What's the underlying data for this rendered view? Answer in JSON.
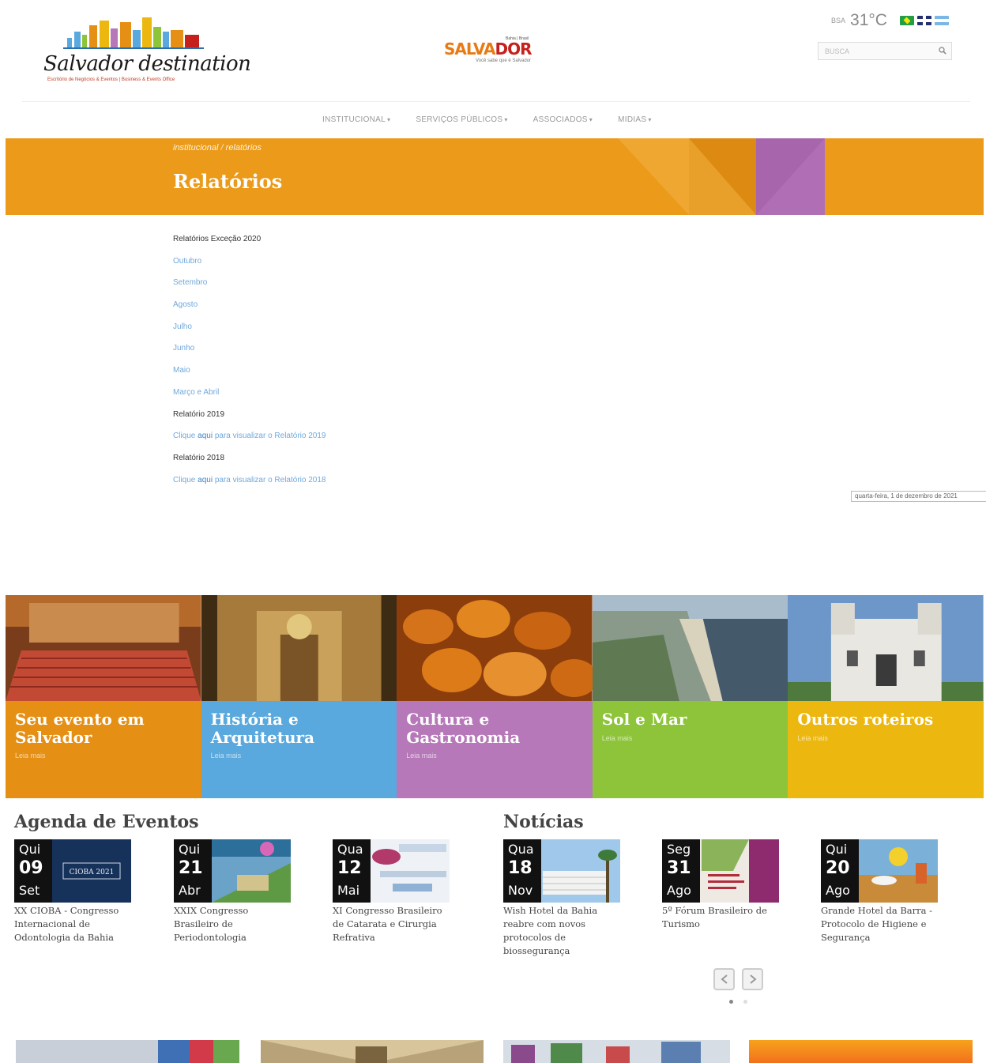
{
  "header": {
    "logo_text": "Salvador destination",
    "logo_subtitle": "Escritório de Negócios & Eventos | Business & Events Office",
    "center_logo_top": "Bahia | Brasil",
    "center_logo_word_a": "SALVA",
    "center_logo_word_b": "DOR",
    "center_logo_tagline": "Você sabe que é Salvador",
    "weather_city": "BSA",
    "weather_temp": "31°C",
    "search_placeholder": "BUSCA"
  },
  "nav": {
    "items": [
      {
        "label": "INSTITUCIONAL"
      },
      {
        "label": "SERVIÇOS PÚBLICOS"
      },
      {
        "label": "ASSOCIADOS"
      },
      {
        "label": "MIDIAS"
      }
    ],
    "caret": "▾"
  },
  "banner": {
    "crumb_a": "institucional",
    "crumb_sep": " / ",
    "crumb_b": "relatórios",
    "title": "Relatórios",
    "colors": {
      "base": "#eb9a19",
      "accent": "#b06fb4"
    }
  },
  "content": {
    "items": [
      {
        "type": "heading",
        "text": "Relatórios Exceção 2020"
      },
      {
        "type": "link",
        "text": "Outubro"
      },
      {
        "type": "link",
        "text": "Setembro"
      },
      {
        "type": "link",
        "text": "Agosto"
      },
      {
        "type": "link",
        "text": "Julho"
      },
      {
        "type": "link",
        "text": "Junho"
      },
      {
        "type": "link",
        "text": "Maio"
      },
      {
        "type": "link",
        "text": "Março e Abril"
      },
      {
        "type": "heading",
        "text": "Relatório 2019"
      },
      {
        "type": "link",
        "prefix": "Clique ",
        "here": "aqui",
        "suffix": " para visualizar o Relatório 2019"
      },
      {
        "type": "heading",
        "text": "Relatório 2018"
      },
      {
        "type": "link",
        "prefix": "Clique ",
        "here": "aqui",
        "suffix": " para visualizar o Relatório 2018"
      }
    ],
    "date_box": "quarta-feira, 1 de dezembro de 2021"
  },
  "tiles": [
    {
      "title": "Seu evento em Salvador",
      "more": "Leia mais",
      "color": "#e58f14"
    },
    {
      "title": "História e Arquitetura",
      "more": "Leia mais",
      "color": "#5aa9de"
    },
    {
      "title": "Cultura e Gastronomia",
      "more": "Leia mais",
      "color": "#b678b9"
    },
    {
      "title": "Sol e Mar",
      "more": "Leia mais",
      "color": "#8ec43a"
    },
    {
      "title": "Outros roteiros",
      "more": "Leia mais",
      "color": "#ecb70f"
    }
  ],
  "agenda": {
    "title": "Agenda de Eventos",
    "cards": [
      {
        "dow": "Qui",
        "day": "09",
        "mon": "Set",
        "title": "XX CIOBA - Congresso Internacional de Odontologia da Bahia",
        "img_label": "CIOBA 2021"
      },
      {
        "dow": "Qui",
        "day": "21",
        "mon": "Abr",
        "title": "XXIX Congresso Brasileiro de Periodontologia"
      },
      {
        "dow": "Qua",
        "day": "12",
        "mon": "Mai",
        "title": "XI Congresso Brasileiro de Catarata e Cirurgia Refrativa"
      }
    ]
  },
  "news": {
    "title": "Notícias",
    "cards": [
      {
        "dow": "Qua",
        "day": "18",
        "mon": "Nov",
        "title": "Wish Hotel da Bahia reabre com novos protocolos de biossegurança"
      },
      {
        "dow": "Seg",
        "day": "31",
        "mon": "Ago",
        "title": "5º Fórum Brasileiro de Turismo"
      },
      {
        "dow": "Qui",
        "day": "20",
        "mon": "Ago",
        "title": "Grande Hotel da Barra - Protocolo de Higiene e Segurança"
      }
    ]
  }
}
